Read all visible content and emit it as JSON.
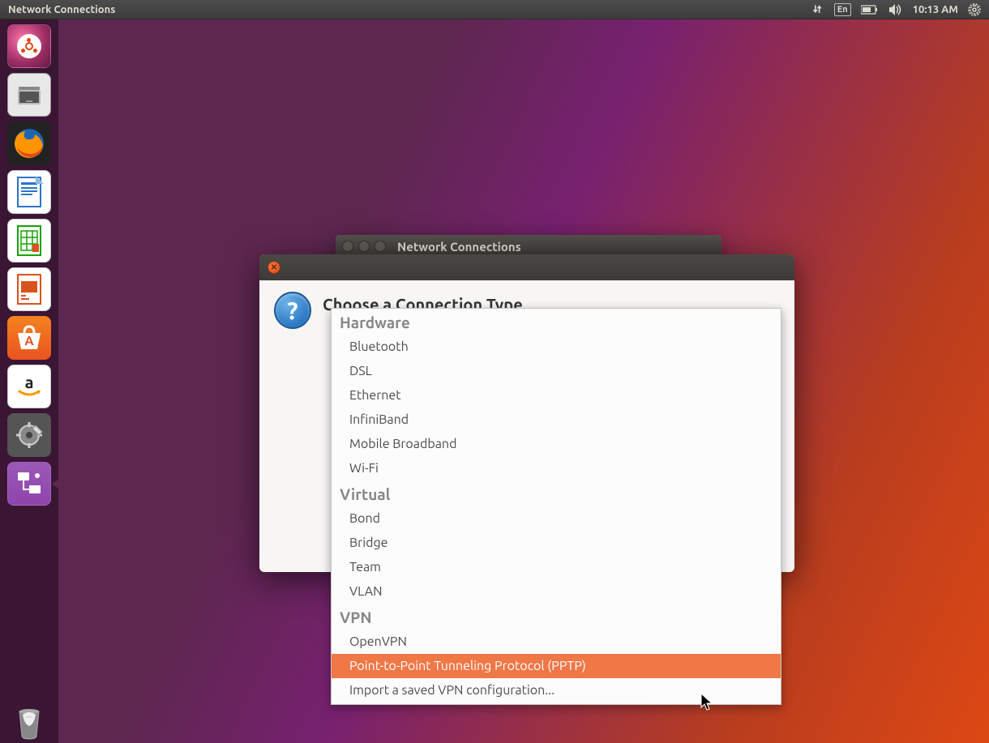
{
  "top_bar": {
    "title": "Network Connections",
    "lang": "En",
    "time": "10:13 AM"
  },
  "launcher": {
    "items": [
      {
        "name": "dash",
        "label": "Dash"
      },
      {
        "name": "files",
        "label": "Files"
      },
      {
        "name": "firefox",
        "label": "Firefox"
      },
      {
        "name": "writer",
        "label": "LibreOffice Writer"
      },
      {
        "name": "calc",
        "label": "LibreOffice Calc"
      },
      {
        "name": "impress",
        "label": "LibreOffice Impress"
      },
      {
        "name": "software",
        "label": "Ubuntu Software"
      },
      {
        "name": "amazon",
        "label": "Amazon"
      },
      {
        "name": "settings",
        "label": "System Settings"
      },
      {
        "name": "network",
        "label": "Network Connections"
      }
    ],
    "trash": "Trash"
  },
  "back_window": {
    "title": "Network Connections"
  },
  "dialog": {
    "heading": "Choose a Connection Type"
  },
  "dropdown": {
    "group_hardware": "Hardware",
    "hw_bluetooth": "Bluetooth",
    "hw_dsl": "DSL",
    "hw_ethernet": "Ethernet",
    "hw_infiniband": "InfiniBand",
    "hw_mobile": "Mobile Broadband",
    "hw_wifi": "Wi-Fi",
    "group_virtual": "Virtual",
    "v_bond": "Bond",
    "v_bridge": "Bridge",
    "v_team": "Team",
    "v_vlan": "VLAN",
    "group_vpn": "VPN",
    "vpn_openvpn": "OpenVPN",
    "vpn_pptp": "Point-to-Point Tunneling Protocol (PPTP)",
    "vpn_import": "Import a saved VPN configuration..."
  }
}
